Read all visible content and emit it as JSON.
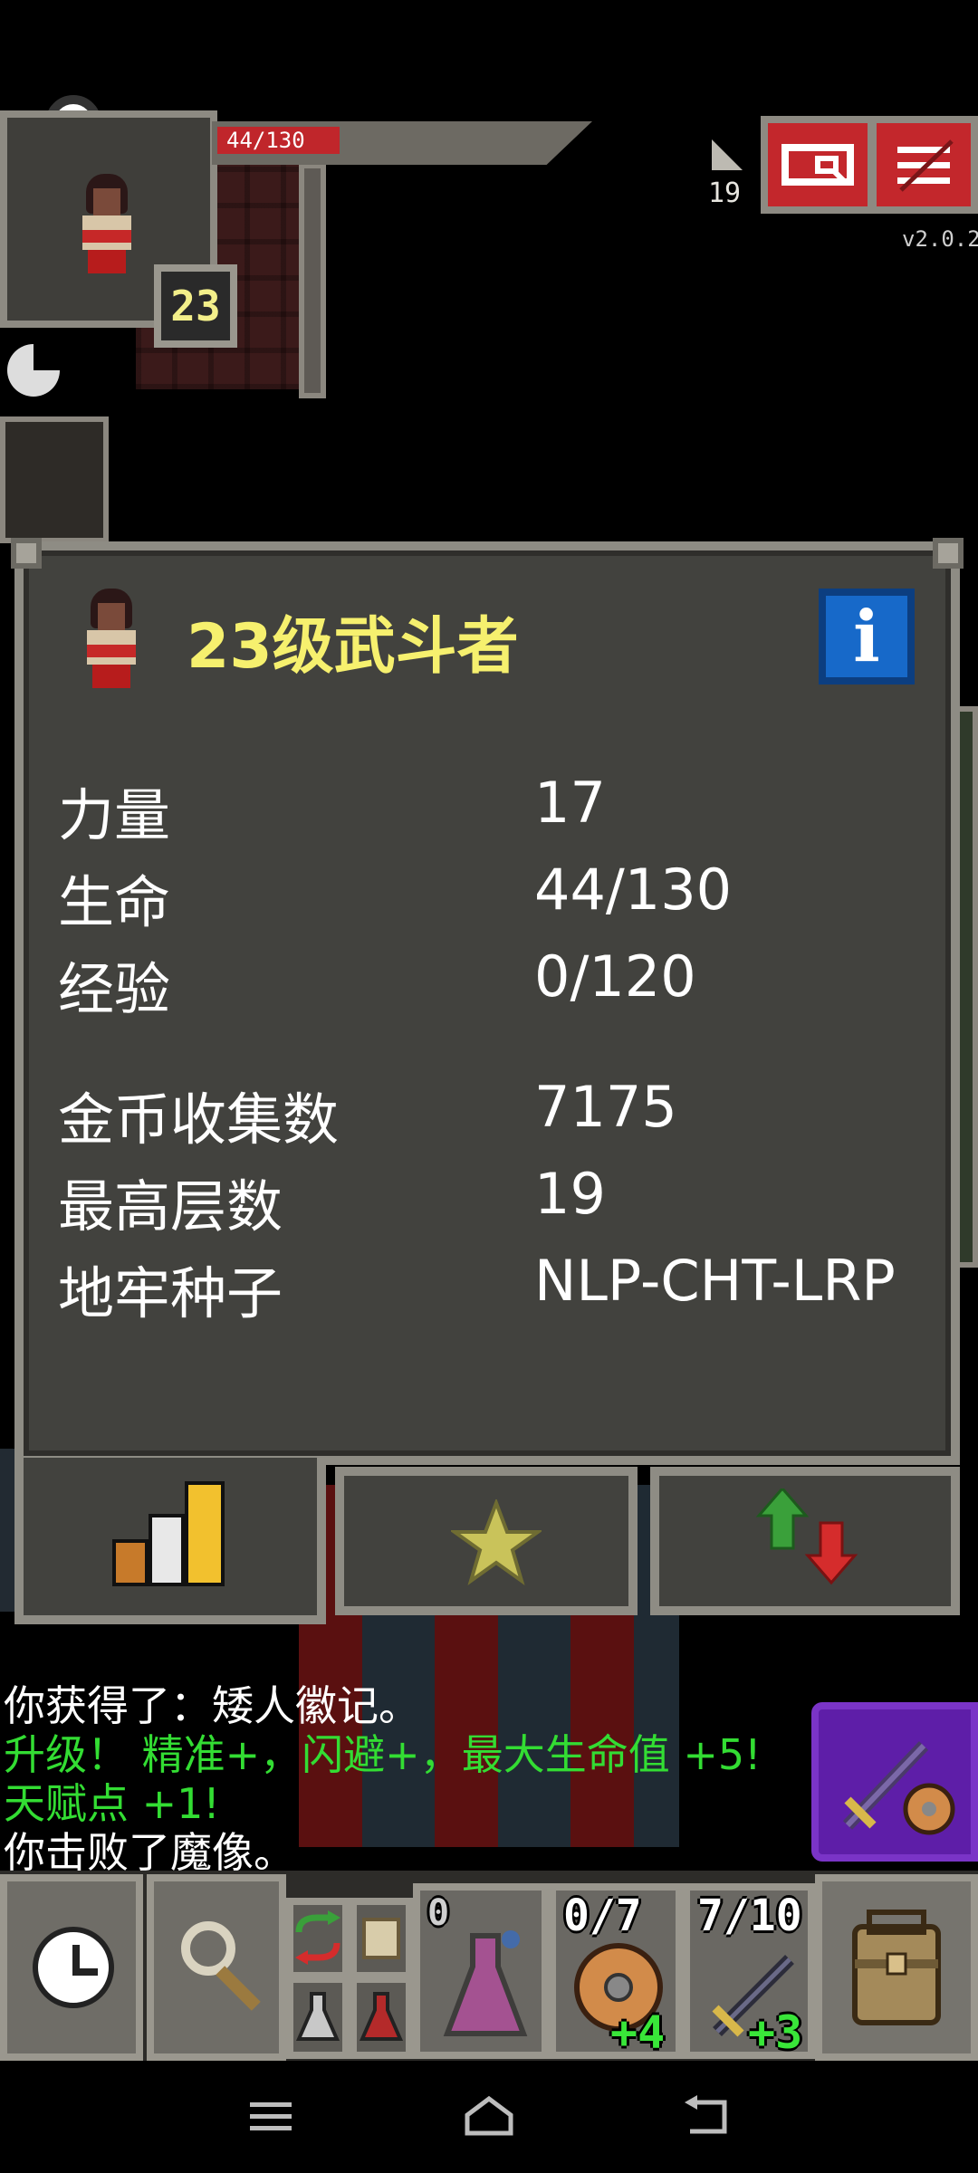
{
  "hud": {
    "hp_text": "44/130",
    "hp_fraction": 0.338,
    "hero_level": "23",
    "depth": "19",
    "version": "v2.0.2",
    "journal_icon": "journal-icon",
    "menu_icon": "menu-icon"
  },
  "stats_window": {
    "title": "23级武斗者",
    "info_label": "i",
    "rows": [
      {
        "label": "力量",
        "value": "17"
      },
      {
        "label": "生命",
        "value": "44/130"
      },
      {
        "label": "经验",
        "value": "0/120"
      },
      {
        "label": "金币收集数",
        "value": "7175"
      },
      {
        "label": "最高层数",
        "value": "19"
      },
      {
        "label": "地牢种子",
        "value": "NLP-CHT-LRP"
      }
    ],
    "tabs": [
      "stats-tab-icon",
      "talents-tab-icon",
      "buffs-tab-icon"
    ]
  },
  "log": [
    {
      "text": "你获得了：矮人徽记。",
      "color": "#ffffff"
    },
    {
      "text": "升级！ 精准+，闪避+，最大生命值 +5!",
      "color": "#33dd33"
    },
    {
      "text": "天赋点 +1!",
      "color": "#33dd33"
    },
    {
      "text": "你击败了魔像。",
      "color": "#ffffff"
    }
  ],
  "toolbar": {
    "potion_count": "0",
    "shield_charge": "0/7",
    "shield_bonus": "+4",
    "sword_charge": "7/10",
    "sword_bonus": "+3"
  },
  "colors": {
    "accent_red": "#c3272c",
    "log_green": "#33dd33",
    "title_yellow": "#f6f06e",
    "info_blue": "#1769c9",
    "quickslot_purple": "#5e1ea8"
  }
}
